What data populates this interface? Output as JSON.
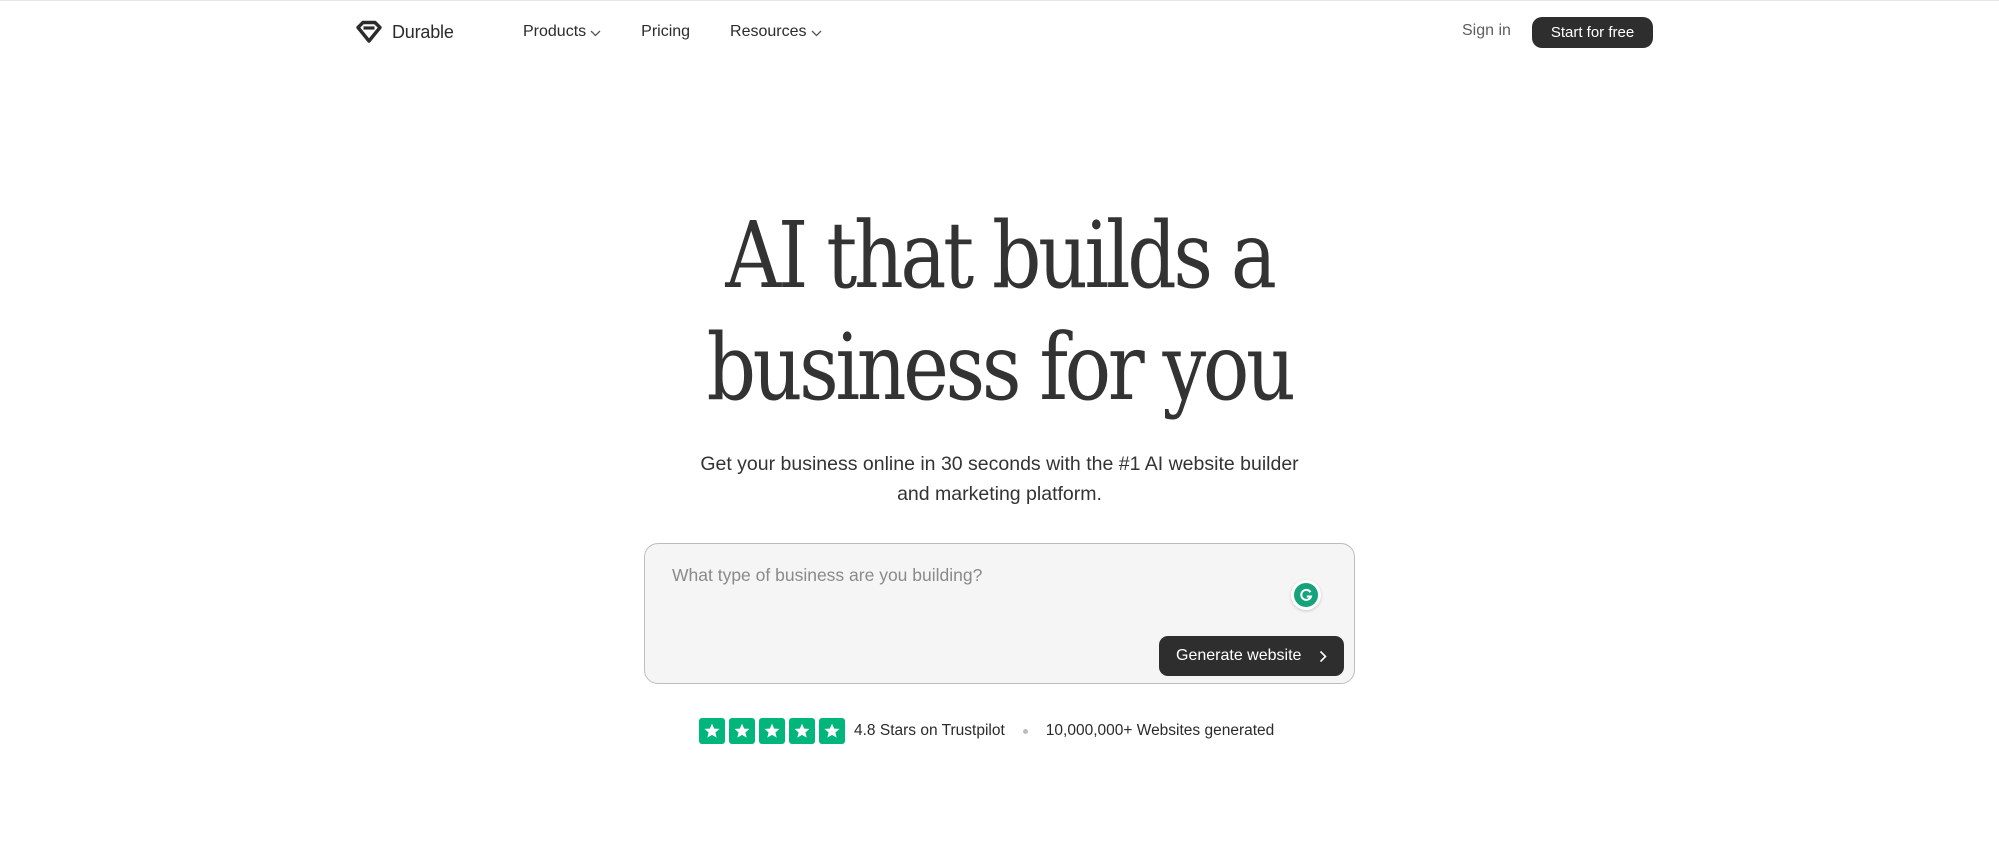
{
  "brand": {
    "name": "Durable"
  },
  "nav": {
    "items": [
      {
        "label": "Products",
        "has_dropdown": true
      },
      {
        "label": "Pricing",
        "has_dropdown": false
      },
      {
        "label": "Resources",
        "has_dropdown": true
      }
    ],
    "sign_in": "Sign in",
    "cta": "Start for free"
  },
  "hero": {
    "title_line1": "AI that builds a",
    "title_line2": "business for you",
    "subtitle": "Get your business online in 30 seconds with the #1 AI website builder and marketing platform."
  },
  "prompt": {
    "placeholder": "What type of business are you building?",
    "value": "",
    "button_label": "Generate website"
  },
  "social_proof": {
    "star_count": 5,
    "rating_text": "4.8 Stars on Trustpilot",
    "websites_text": "10,000,000+ Websites generated"
  },
  "colors": {
    "dark": "#2e2e2e",
    "trustpilot_green": "#00b67a",
    "grammarly_green": "#15a37c"
  },
  "icons": [
    "durable-logo-icon",
    "chevron-down-icon",
    "grammarly-icon",
    "chevron-right-icon",
    "star-icon"
  ]
}
